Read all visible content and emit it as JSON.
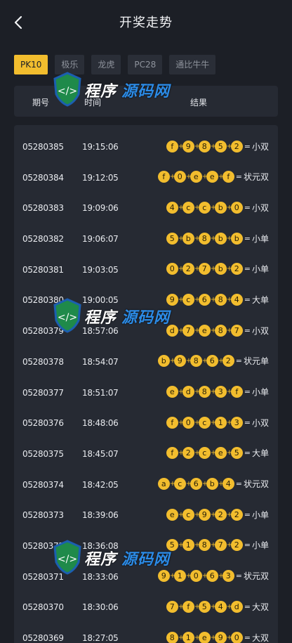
{
  "header": {
    "title": "开奖走势",
    "back_icon": "chevron-left-icon"
  },
  "tabs": [
    {
      "label": "PK10",
      "active": true
    },
    {
      "label": "极乐",
      "active": false
    },
    {
      "label": "龙虎",
      "active": false
    },
    {
      "label": "PC28",
      "active": false
    },
    {
      "label": "通比牛牛",
      "active": false
    }
  ],
  "table_header": {
    "period": "期号",
    "time": "时间",
    "result": "结果"
  },
  "rows": [
    {
      "period": "05280385",
      "time": "19:15:06",
      "balls": [
        "f",
        "9",
        "8",
        "5",
        "2"
      ],
      "label": "小双"
    },
    {
      "period": "05280384",
      "time": "19:12:05",
      "balls": [
        "f",
        "0",
        "e",
        "e",
        "f"
      ],
      "label": "状元双"
    },
    {
      "period": "05280383",
      "time": "19:09:06",
      "balls": [
        "4",
        "c",
        "c",
        "b",
        "0"
      ],
      "label": "小双"
    },
    {
      "period": "05280382",
      "time": "19:06:07",
      "balls": [
        "5",
        "b",
        "8",
        "b",
        "b"
      ],
      "label": "小单"
    },
    {
      "period": "05280381",
      "time": "19:03:05",
      "balls": [
        "0",
        "2",
        "7",
        "b",
        "2"
      ],
      "label": "小单"
    },
    {
      "period": "05280380",
      "time": "19:00:05",
      "balls": [
        "9",
        "c",
        "6",
        "8",
        "4"
      ],
      "label": "大单"
    },
    {
      "period": "05280379",
      "time": "18:57:06",
      "balls": [
        "d",
        "7",
        "e",
        "8",
        "7"
      ],
      "label": "小双"
    },
    {
      "period": "05280378",
      "time": "18:54:07",
      "balls": [
        "b",
        "9",
        "8",
        "6",
        "2"
      ],
      "label": "状元单"
    },
    {
      "period": "05280377",
      "time": "18:51:07",
      "balls": [
        "e",
        "d",
        "8",
        "3",
        "f"
      ],
      "label": "小单"
    },
    {
      "period": "05280376",
      "time": "18:48:06",
      "balls": [
        "f",
        "0",
        "c",
        "1",
        "3"
      ],
      "label": "小双"
    },
    {
      "period": "05280375",
      "time": "18:45:07",
      "balls": [
        "f",
        "2",
        "c",
        "e",
        "5"
      ],
      "label": "大单"
    },
    {
      "period": "05280374",
      "time": "18:42:05",
      "balls": [
        "a",
        "c",
        "6",
        "b",
        "4"
      ],
      "label": "状元双"
    },
    {
      "period": "05280373",
      "time": "18:39:06",
      "balls": [
        "e",
        "c",
        "9",
        "2",
        "2"
      ],
      "label": "小单"
    },
    {
      "period": "05280372",
      "time": "18:36:08",
      "balls": [
        "5",
        "1",
        "8",
        "7",
        "2"
      ],
      "label": "小单"
    },
    {
      "period": "05280371",
      "time": "18:33:06",
      "balls": [
        "9",
        "1",
        "0",
        "6",
        "3"
      ],
      "label": "状元双"
    },
    {
      "period": "05280370",
      "time": "18:30:06",
      "balls": [
        "7",
        "f",
        "5",
        "4",
        "d"
      ],
      "label": "大双"
    },
    {
      "period": "05280369",
      "time": "18:27:05",
      "balls": [
        "8",
        "1",
        "e",
        "9",
        "0"
      ],
      "label": "大双"
    }
  ],
  "watermark": {
    "text_a": "程序",
    "text_b": "源码网",
    "colors": {
      "white": "#ffffff",
      "blue": "#2c8be6",
      "shield": "#1f8a4a"
    }
  },
  "colors": {
    "background": "#1c1f26",
    "panel": "#262a33",
    "accent": "#f2bd2e",
    "tab_inactive": "#2a2e37"
  }
}
